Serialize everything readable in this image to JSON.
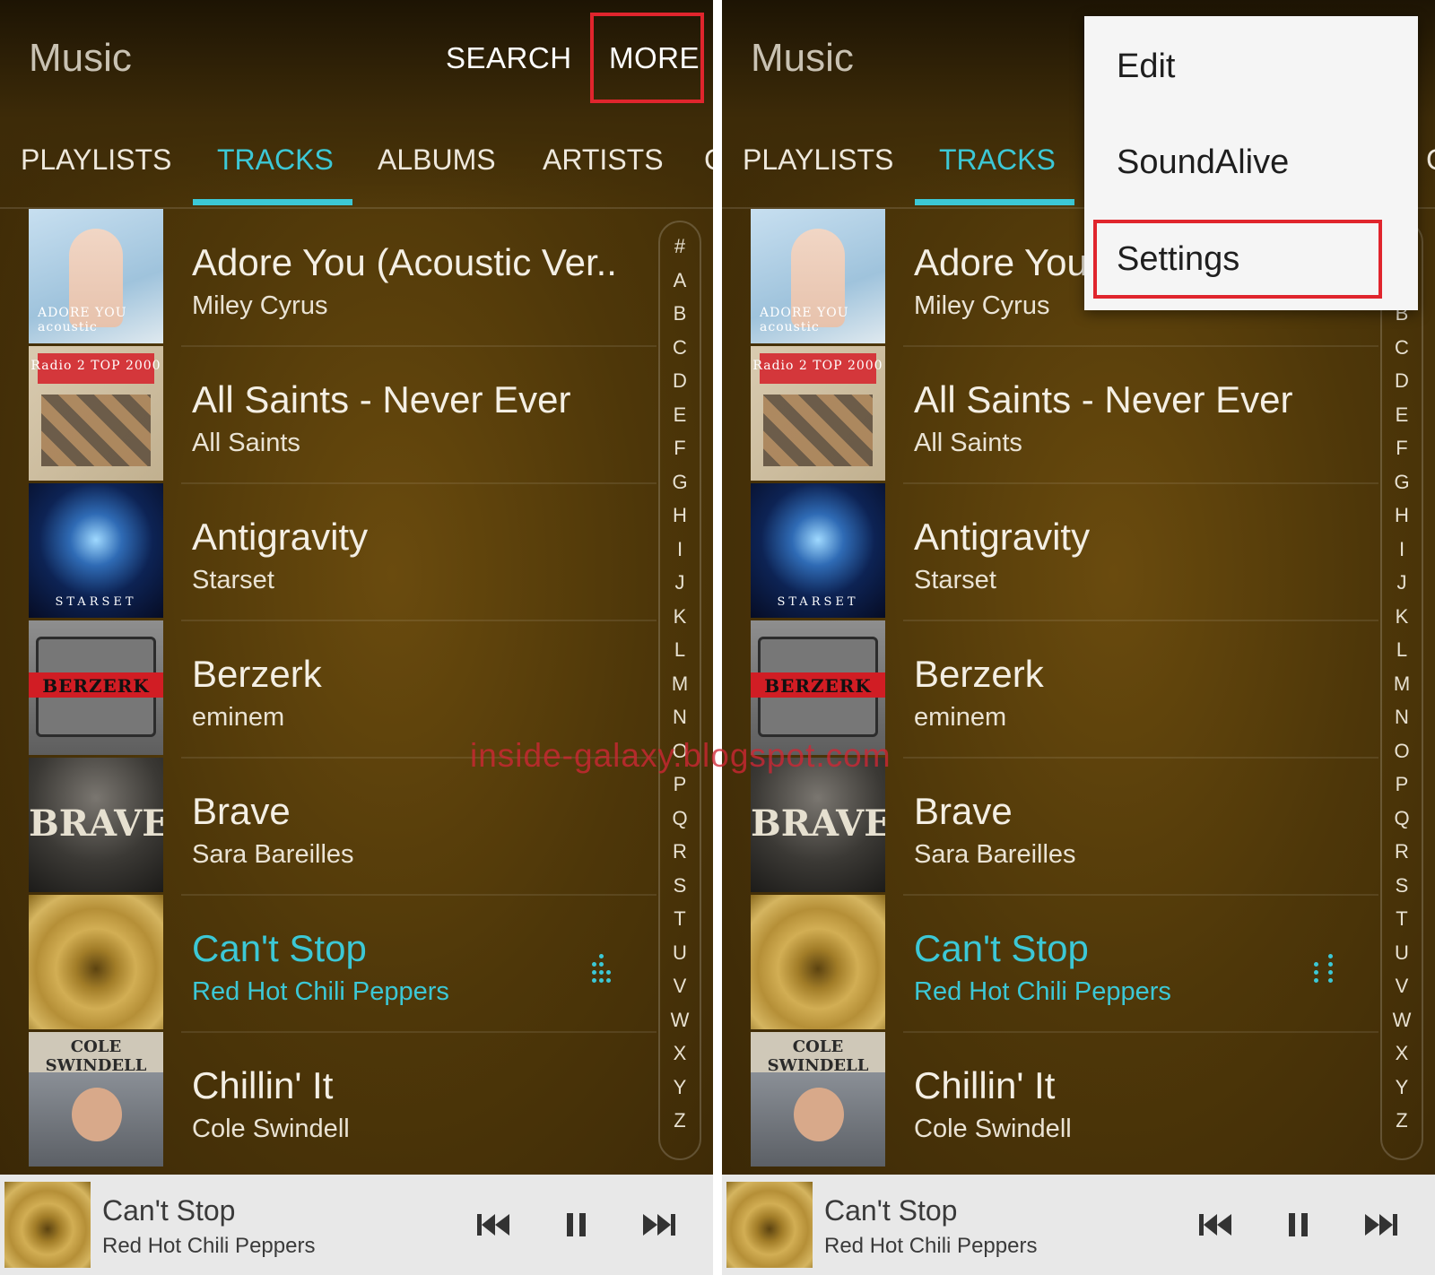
{
  "left": {
    "app_title": "Music",
    "header": {
      "search": "SEARCH",
      "more": "MORE"
    },
    "tabs": [
      "PLAYLISTS",
      "TRACKS",
      "ALBUMS",
      "ARTISTS",
      "C"
    ],
    "active_tab": "TRACKS"
  },
  "right": {
    "app_title": "Music",
    "tabs": [
      "PLAYLISTS",
      "TRACKS",
      "C"
    ],
    "menu": {
      "items": [
        "Edit",
        "SoundAlive",
        "Settings"
      ],
      "highlighted": "Settings"
    }
  },
  "tracks": [
    {
      "title": "Adore You (Acoustic Ver..",
      "title_right": "Adore You",
      "artist": "Miley Cyrus",
      "art_text": "ADORE YOU acoustic"
    },
    {
      "title": "All Saints - Never Ever",
      "artist": "All Saints",
      "art_text": "Radio 2 TOP 2000"
    },
    {
      "title": "Antigravity",
      "artist": "Starset",
      "art_text": "STARSET"
    },
    {
      "title": "Berzerk",
      "artist": "eminem",
      "art_text": "BERZERK"
    },
    {
      "title": "Brave",
      "artist": "Sara Bareilles",
      "art_text": "BRAVE"
    },
    {
      "title": "Can't Stop",
      "artist": "Red Hot Chili Peppers",
      "playing": true
    },
    {
      "title": "Chillin' It",
      "artist": "Cole Swindell",
      "art_text": "COLE SWINDELL"
    }
  ],
  "index_letters": [
    "#",
    "A",
    "B",
    "C",
    "D",
    "E",
    "F",
    "G",
    "H",
    "I",
    "J",
    "K",
    "L",
    "M",
    "N",
    "O",
    "P",
    "Q",
    "R",
    "S",
    "T",
    "U",
    "V",
    "W",
    "X",
    "Y",
    "Z"
  ],
  "mini_player": {
    "title": "Can't Stop",
    "artist": "Red Hot Chili Peppers",
    "controls": [
      "previous-icon",
      "pause-icon",
      "next-icon"
    ]
  },
  "watermark": "inside-galaxy.blogspot.com",
  "colors": {
    "accent": "#3cc8d6",
    "highlight": "#e0252d"
  }
}
